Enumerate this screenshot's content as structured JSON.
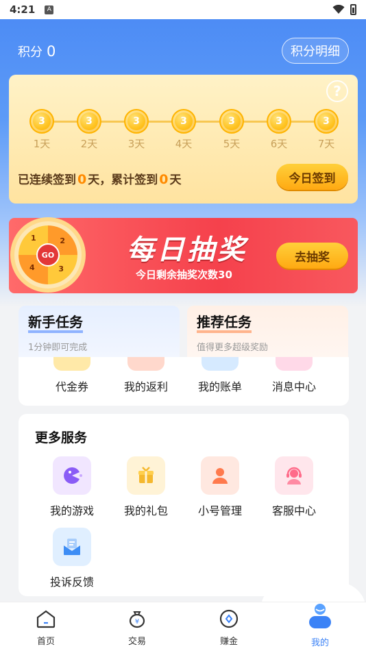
{
  "status_bar": {
    "time": "4:21"
  },
  "header": {
    "points_label": "积分",
    "points_value": "0",
    "points_detail_button": "积分明细"
  },
  "checkin": {
    "help_icon": "?",
    "days": [
      {
        "coin": "3",
        "label": "1天"
      },
      {
        "coin": "3",
        "label": "2天"
      },
      {
        "coin": "3",
        "label": "3天"
      },
      {
        "coin": "3",
        "label": "4天"
      },
      {
        "coin": "3",
        "label": "5天"
      },
      {
        "coin": "3",
        "label": "6天"
      },
      {
        "coin": "3",
        "label": "7天"
      }
    ],
    "streak_prefix": "已连续签到",
    "streak_value": "0",
    "streak_mid": "天，累计签到",
    "total_value": "0",
    "streak_suffix": "天",
    "checkin_button": "今日签到"
  },
  "lottery": {
    "wheel_go": "GO",
    "wheel_numbers": [
      "1",
      "2",
      "3",
      "4"
    ],
    "title": "每日抽奖",
    "subtitle": "今日剩余抽奖次数30",
    "button": "去抽奖"
  },
  "tasks": {
    "new_title": "新手任务",
    "new_sub": "1分钟即可完成",
    "rec_title": "推荐任务",
    "rec_sub": "值得更多超级奖励"
  },
  "menu": {
    "items": [
      {
        "label": "代金券",
        "icon": "voucher-icon",
        "color": "#ffe9a8"
      },
      {
        "label": "我的返利",
        "icon": "rebate-icon",
        "color": "#ffd8cc"
      },
      {
        "label": "我的账单",
        "icon": "bill-icon",
        "color": "#d6eaff"
      },
      {
        "label": "消息中心",
        "icon": "message-icon",
        "color": "#ffd9e8"
      }
    ]
  },
  "services": {
    "title": "更多服务",
    "items": [
      {
        "label": "我的游戏",
        "icon": "game-icon",
        "color": "#f1e6ff"
      },
      {
        "label": "我的礼包",
        "icon": "gift-icon",
        "color": "#fff3d6"
      },
      {
        "label": "小号管理",
        "icon": "account-icon",
        "color": "#ffe8e0"
      },
      {
        "label": "客服中心",
        "icon": "customer-service-icon",
        "color": "#ffe6ec"
      },
      {
        "label": "投诉反馈",
        "icon": "feedback-icon",
        "color": "#e0efff"
      }
    ]
  },
  "nav": {
    "items": [
      {
        "label": "首页",
        "icon": "home-icon"
      },
      {
        "label": "交易",
        "icon": "trade-icon"
      },
      {
        "label": "赚金",
        "icon": "earn-icon"
      },
      {
        "label": "我的",
        "icon": "profile-icon"
      }
    ],
    "active_color": "#3b82f6"
  }
}
